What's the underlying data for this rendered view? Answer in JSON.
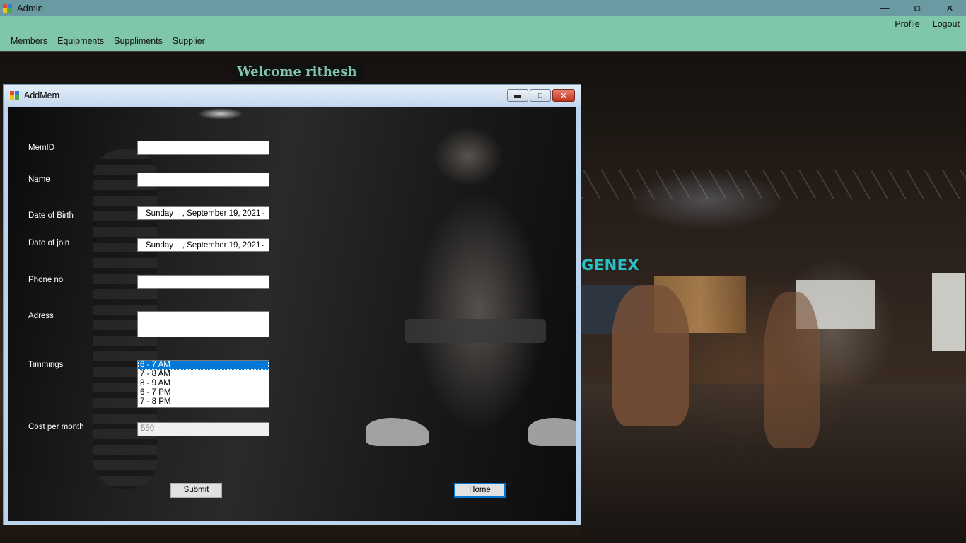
{
  "window": {
    "title": "Admin"
  },
  "menu": {
    "left": [
      "Members",
      "Equipments",
      "Suppliments",
      "Supplier"
    ],
    "right": [
      "Profile",
      "Logout"
    ]
  },
  "welcome": "Welcome rithesh",
  "background": {
    "sign": "GENEX"
  },
  "child": {
    "title": "AddMem",
    "fields": {
      "memid": {
        "label": "MemID",
        "value": ""
      },
      "name": {
        "label": "Name",
        "value": ""
      },
      "dob": {
        "label": "Date of Birth",
        "value": "Sunday    , September 19, 2021"
      },
      "doj": {
        "label": "Date of join",
        "value": "Sunday    , September 19, 2021"
      },
      "phone": {
        "label": "Phone no",
        "value": ""
      },
      "address": {
        "label": "Adress",
        "value": ""
      },
      "timings": {
        "label": "Timmings",
        "options": [
          "6 - 7  AM",
          "7 - 8  AM",
          "8 - 9  AM",
          "6 - 7  PM",
          "7 - 8  PM"
        ],
        "selected": "6 - 7  AM"
      },
      "cost": {
        "label": "Cost per month",
        "value": "550"
      }
    },
    "buttons": {
      "submit": "Submit",
      "home": "Home"
    }
  },
  "colors": {
    "titlebar": "#6b9ba2",
    "menubar": "#7fc6ab",
    "selection": "#0078d7"
  },
  "icons": {
    "app": "app-icon",
    "minimize": "minimize-icon",
    "restore": "restore-icon",
    "close": "close-icon",
    "dropdown": "chevron-down-icon"
  }
}
